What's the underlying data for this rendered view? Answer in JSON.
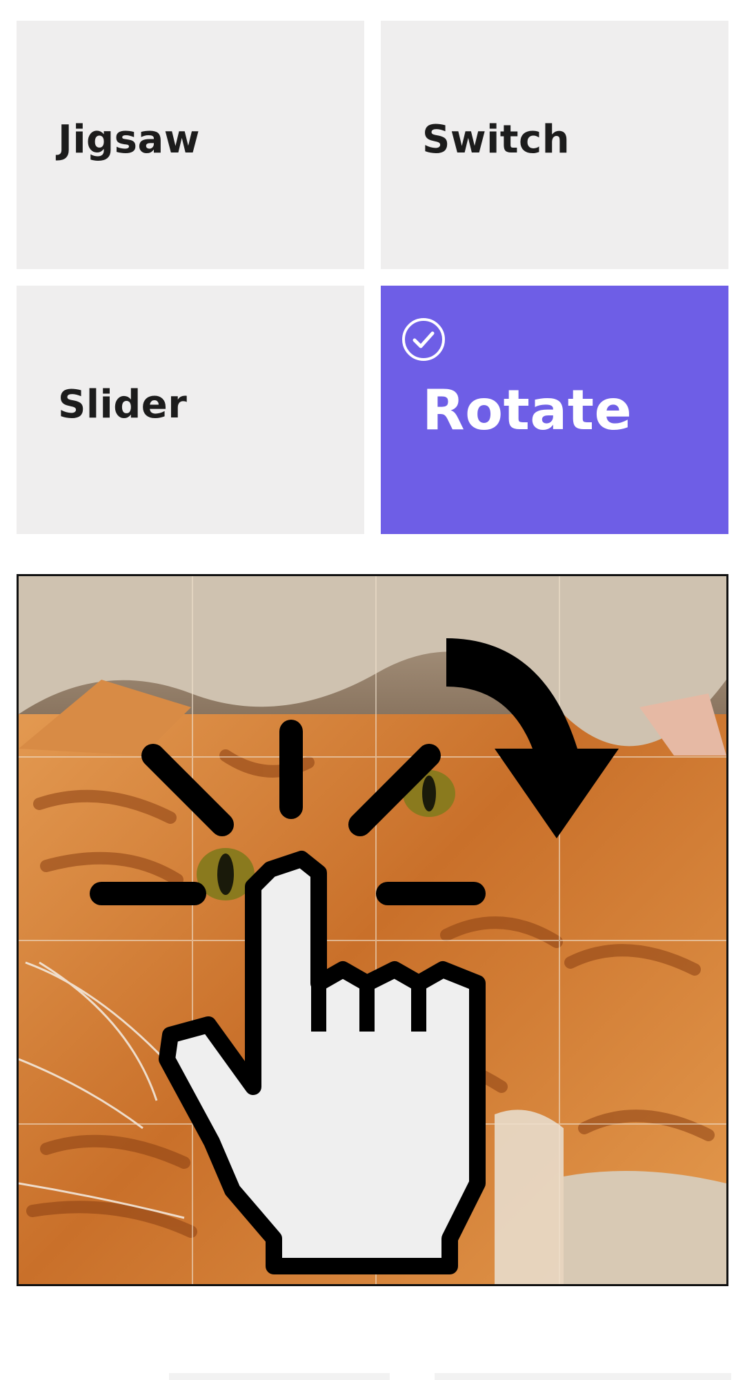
{
  "modes": [
    {
      "id": "jigsaw",
      "label": "Jigsaw",
      "selected": false
    },
    {
      "id": "switch",
      "label": "Switch",
      "selected": false
    },
    {
      "id": "slider",
      "label": "Slider",
      "selected": false
    },
    {
      "id": "rotate",
      "label": "Rotate",
      "selected": true
    }
  ],
  "colors": {
    "selected_tile": "#6e5ee6",
    "tile": "#efeeee",
    "text": "#1c1c1c"
  },
  "board": {
    "grid": "4x4",
    "image": "orange-tabby-cat-photo",
    "hint_icons": [
      "tap-hand-icon",
      "rotate-clockwise-arrow-icon"
    ]
  }
}
